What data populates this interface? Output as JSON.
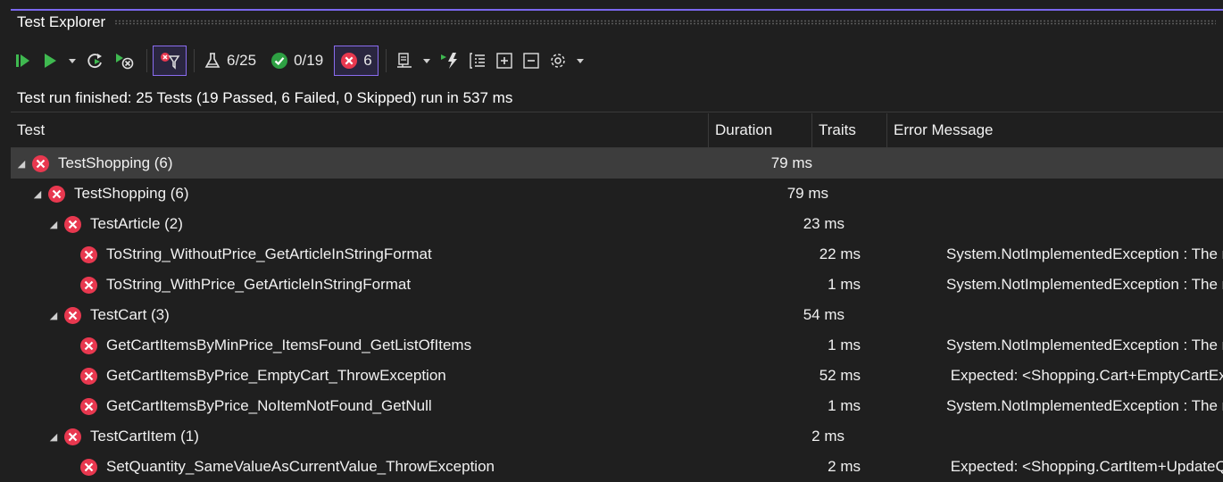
{
  "window": {
    "title": "Test Explorer"
  },
  "toolbar": {
    "tested_count": "6/25",
    "passed_count": "0/19",
    "failed_count": "6",
    "icons": [
      "run-all-icon",
      "run-icon",
      "dropdown-icon",
      "repeat-last-run-icon",
      "run-failed-icon",
      "filter-icon",
      "flask-icon",
      "passed-icon",
      "failed-icon",
      "playlist-icon",
      "dropdown-icon",
      "live-unit-testing-icon",
      "group-icon",
      "expand-all-icon",
      "collapse-all-icon",
      "settings-icon",
      "dropdown-icon"
    ]
  },
  "status": {
    "text": "Test run finished: 25 Tests (19 Passed, 6 Failed, 0 Skipped) run in 537 ms"
  },
  "columns": {
    "test": "Test",
    "duration": "Duration",
    "traits": "Traits",
    "error": "Error Message"
  },
  "colors": {
    "accent": "#7b68ee",
    "fail": "#e8384f",
    "pass": "#2ea043"
  },
  "rows": [
    {
      "level": 0,
      "expanded": true,
      "name": "TestShopping (6)",
      "duration": "79 ms",
      "error": ""
    },
    {
      "level": 1,
      "expanded": true,
      "name": "TestShopping (6)",
      "duration": "79 ms",
      "error": ""
    },
    {
      "level": 2,
      "expanded": true,
      "name": "TestArticle (2)",
      "duration": "23 ms",
      "error": ""
    },
    {
      "level": 3,
      "expanded": null,
      "name": "ToString_WithoutPrice_GetArticleInStringFormat",
      "duration": "22 ms",
      "error": "System.NotImplementedException : The m"
    },
    {
      "level": 3,
      "expanded": null,
      "name": "ToString_WithPrice_GetArticleInStringFormat",
      "duration": "1 ms",
      "error": "System.NotImplementedException : The m"
    },
    {
      "level": 2,
      "expanded": true,
      "name": "TestCart (3)",
      "duration": "54 ms",
      "error": ""
    },
    {
      "level": 3,
      "expanded": null,
      "name": "GetCartItemsByMinPrice_ItemsFound_GetListOfItems",
      "duration": "1 ms",
      "error": "System.NotImplementedException : The m"
    },
    {
      "level": 3,
      "expanded": null,
      "name": "GetCartItemsByPrice_EmptyCart_ThrowException",
      "duration": "52 ms",
      "error": " Expected: <Shopping.Cart+EmptyCartExc"
    },
    {
      "level": 3,
      "expanded": null,
      "name": "GetCartItemsByPrice_NoItemNotFound_GetNull",
      "duration": "1 ms",
      "error": "System.NotImplementedException : The m"
    },
    {
      "level": 2,
      "expanded": true,
      "name": "TestCartItem (1)",
      "duration": "2 ms",
      "error": ""
    },
    {
      "level": 3,
      "expanded": null,
      "name": "SetQuantity_SameValueAsCurrentValue_ThrowException",
      "duration": "2 ms",
      "error": " Expected: <Shopping.CartItem+UpdateQ"
    }
  ]
}
